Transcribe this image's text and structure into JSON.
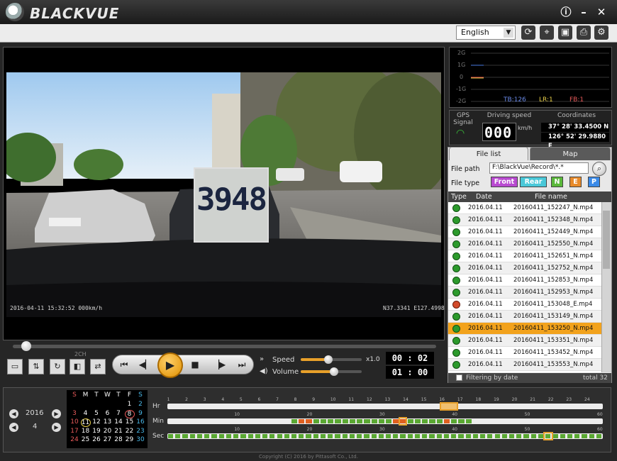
{
  "app": {
    "brand": "BLACKVUE",
    "language": "English"
  },
  "window_controls": {
    "info": "ⓘ",
    "minimize": "–",
    "close": "✕"
  },
  "video": {
    "overlay_left": "2016-04-11 15:32:52 000km/h",
    "overlay_right": "N37.3341 E127.4998",
    "zoom_text": "3948"
  },
  "playback": {
    "speed_label": "Speed",
    "speed_value": "x1.0",
    "speed_level": 0.45,
    "volume_label": "Volume",
    "volume_level": 0.55,
    "elapsed": "00 : 02",
    "duration": "01 : 00",
    "channel_label": "2CH"
  },
  "gsensor": {
    "labels": [
      "2G",
      "1G",
      "0",
      "-1G",
      "-2G"
    ],
    "tb": "TB:126",
    "lr": "LR:1",
    "fb": "FB:1"
  },
  "info": {
    "gps_label": "GPS Signal",
    "speed_label": "Driving speed",
    "speed_value": "000",
    "speed_unit": "km/h",
    "coord_label": "Coordinates",
    "lat": "37° 28' 33.4500 N",
    "lon": "126° 52' 29.9880 E"
  },
  "filelist": {
    "tab_list": "File list",
    "tab_map": "Map",
    "path_label": "File path",
    "path_value": "F:\\BlackVue\\Record\\*.*",
    "type_label": "File type",
    "types": {
      "front": "Front",
      "rear": "Rear",
      "n": "N",
      "e": "E",
      "p": "P"
    },
    "col_type": "Type",
    "col_date": "Date",
    "col_name": "File name",
    "rows": [
      {
        "date": "2016.04.11",
        "name": "20160411_152247_N.mp4",
        "event": false
      },
      {
        "date": "2016.04.11",
        "name": "20160411_152348_N.mp4",
        "event": false
      },
      {
        "date": "2016.04.11",
        "name": "20160411_152449_N.mp4",
        "event": false
      },
      {
        "date": "2016.04.11",
        "name": "20160411_152550_N.mp4",
        "event": false
      },
      {
        "date": "2016.04.11",
        "name": "20160411_152651_N.mp4",
        "event": false
      },
      {
        "date": "2016.04.11",
        "name": "20160411_152752_N.mp4",
        "event": false
      },
      {
        "date": "2016.04.11",
        "name": "20160411_152853_N.mp4",
        "event": false
      },
      {
        "date": "2016.04.11",
        "name": "20160411_152953_N.mp4",
        "event": false
      },
      {
        "date": "2016.04.11",
        "name": "20160411_153048_E.mp4",
        "event": true
      },
      {
        "date": "2016.04.11",
        "name": "20160411_153149_N.mp4",
        "event": false
      },
      {
        "date": "2016.04.11",
        "name": "20160411_153250_N.mp4",
        "event": false,
        "selected": true
      },
      {
        "date": "2016.04.11",
        "name": "20160411_153351_N.mp4",
        "event": false
      },
      {
        "date": "2016.04.11",
        "name": "20160411_153452_N.mp4",
        "event": false
      },
      {
        "date": "2016.04.11",
        "name": "20160411_153553_N.mp4",
        "event": false
      }
    ],
    "filter_label": "Filtering by date",
    "total_label": "total 32"
  },
  "calendar": {
    "year": "2016",
    "month": "4",
    "weekdays": [
      "S",
      "M",
      "T",
      "W",
      "T",
      "F",
      "S"
    ],
    "weeks": [
      [
        "",
        "",
        "",
        "",
        "",
        "1",
        "2"
      ],
      [
        "3",
        "4",
        "5",
        "6",
        "7",
        "8",
        "9"
      ],
      [
        "10",
        "11",
        "12",
        "13",
        "14",
        "15",
        "16"
      ],
      [
        "17",
        "18",
        "19",
        "20",
        "21",
        "22",
        "23"
      ],
      [
        "24",
        "25",
        "26",
        "27",
        "28",
        "29",
        "30"
      ]
    ]
  },
  "timeline": {
    "hr_label": "Hr",
    "min_label": "Min",
    "sec_label": "Sec",
    "hr_ticks": [
      "1",
      "2",
      "3",
      "4",
      "5",
      "6",
      "7",
      "8",
      "9",
      "10",
      "11",
      "12",
      "13",
      "14",
      "15",
      "16",
      "17",
      "18",
      "19",
      "20",
      "21",
      "22",
      "23",
      "24"
    ],
    "min_ticks": [
      "10",
      "20",
      "30",
      "40",
      "50",
      "60"
    ],
    "sec_ticks": [
      "10",
      "20",
      "30",
      "40",
      "50",
      "60"
    ]
  },
  "footer": "Copyright (C) 2016 by Pittasoft Co., Ltd.",
  "colors": {
    "accent": "#e8a02a",
    "selected_row": "#f2a21c",
    "normal_marker": "#5aa832",
    "event_marker": "#e06020"
  }
}
